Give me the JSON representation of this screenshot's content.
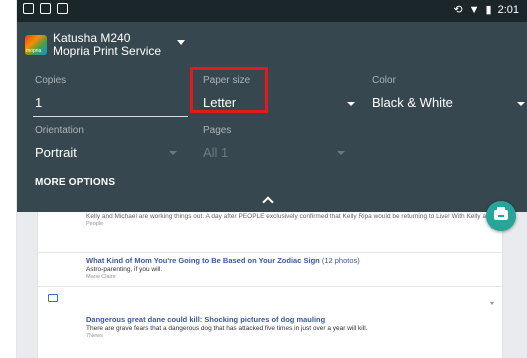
{
  "status_bar": {
    "time": "2:01"
  },
  "printer": {
    "name": "Katusha M240",
    "service": "Mopria Print Service",
    "logo_text": "mopria"
  },
  "copies": {
    "label": "Copies",
    "value": "1"
  },
  "paper_size": {
    "label": "Paper size",
    "value": "Letter"
  },
  "color": {
    "label": "Color",
    "value": "Black & White"
  },
  "orientation": {
    "label": "Orientation",
    "value": "Portrait"
  },
  "pages": {
    "label": "Pages",
    "value": "All 1"
  },
  "more_options": "MORE OPTIONS",
  "highlight_color": "#e3191e",
  "panel_color": "#37474f",
  "fab_color": "#26a69a",
  "feed": [
    {
      "title": "",
      "description": "Kelly and Michael are working things out. A day after PEOPLE exclusively confirmed that Kelly Ripa would be returning to Live! With Kelly and Michael! after a nearly weeklong absence, a source says Michael Strahan is excited to have her back",
      "source": "People"
    },
    {
      "title": "What Kind of Mom You're Going to Be Based on Your Zodiac Sign",
      "photos": "(12 photos)",
      "description": "Astro-parenting, if you will.",
      "source": "Marie Claire"
    },
    {
      "title": "Dangerous great dane could kill: Shocking pictures of dog mauling",
      "description": "There are grave fears that a dangerous dog that has attacked five times in just over a year will kill.",
      "source": "7News"
    }
  ]
}
